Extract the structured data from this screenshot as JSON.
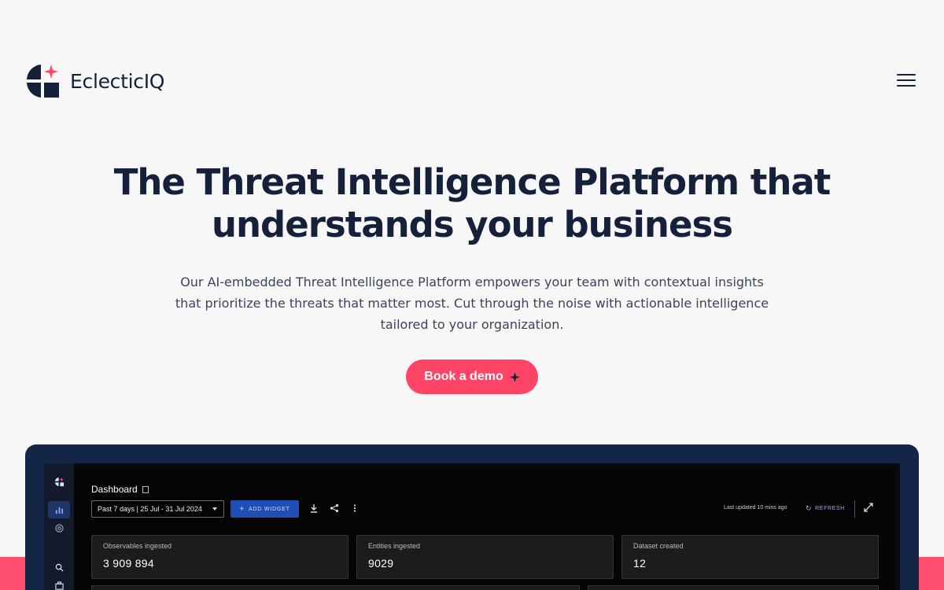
{
  "brand": {
    "name": "EclecticIQ"
  },
  "hero": {
    "title": "The Threat Intelligence Platform that understands your business",
    "subtitle": "Our AI-embedded Threat Intelligence Platform empowers your team with contextual insights that prioritize the threats that matter most. Cut through the noise with actionable intelligence tailored to your organization.",
    "cta_label": "Book a demo"
  },
  "colors": {
    "navy": "#15213a",
    "accent": "#ff4466",
    "frame": "#142647",
    "button_blue": "#1e4fb7"
  },
  "dashboard": {
    "title": "Dashboard",
    "date_range": "Past 7 days | 25 Jul - 31 Jul 2024",
    "add_widget_label": "ADD WIDGET",
    "last_updated": "Last updated 10 mins ago",
    "refresh_label": "REFRESH",
    "icons": [
      "chart-icon",
      "target-icon",
      "search-icon",
      "briefcase-icon",
      "download-icon",
      "share-icon",
      "more-icon",
      "expand-icon"
    ],
    "stats": [
      {
        "label": "Observables ingested",
        "value": "3 909 894"
      },
      {
        "label": "Entities ingested",
        "value": "9029"
      },
      {
        "label": "Dataset created",
        "value": "12"
      }
    ]
  }
}
